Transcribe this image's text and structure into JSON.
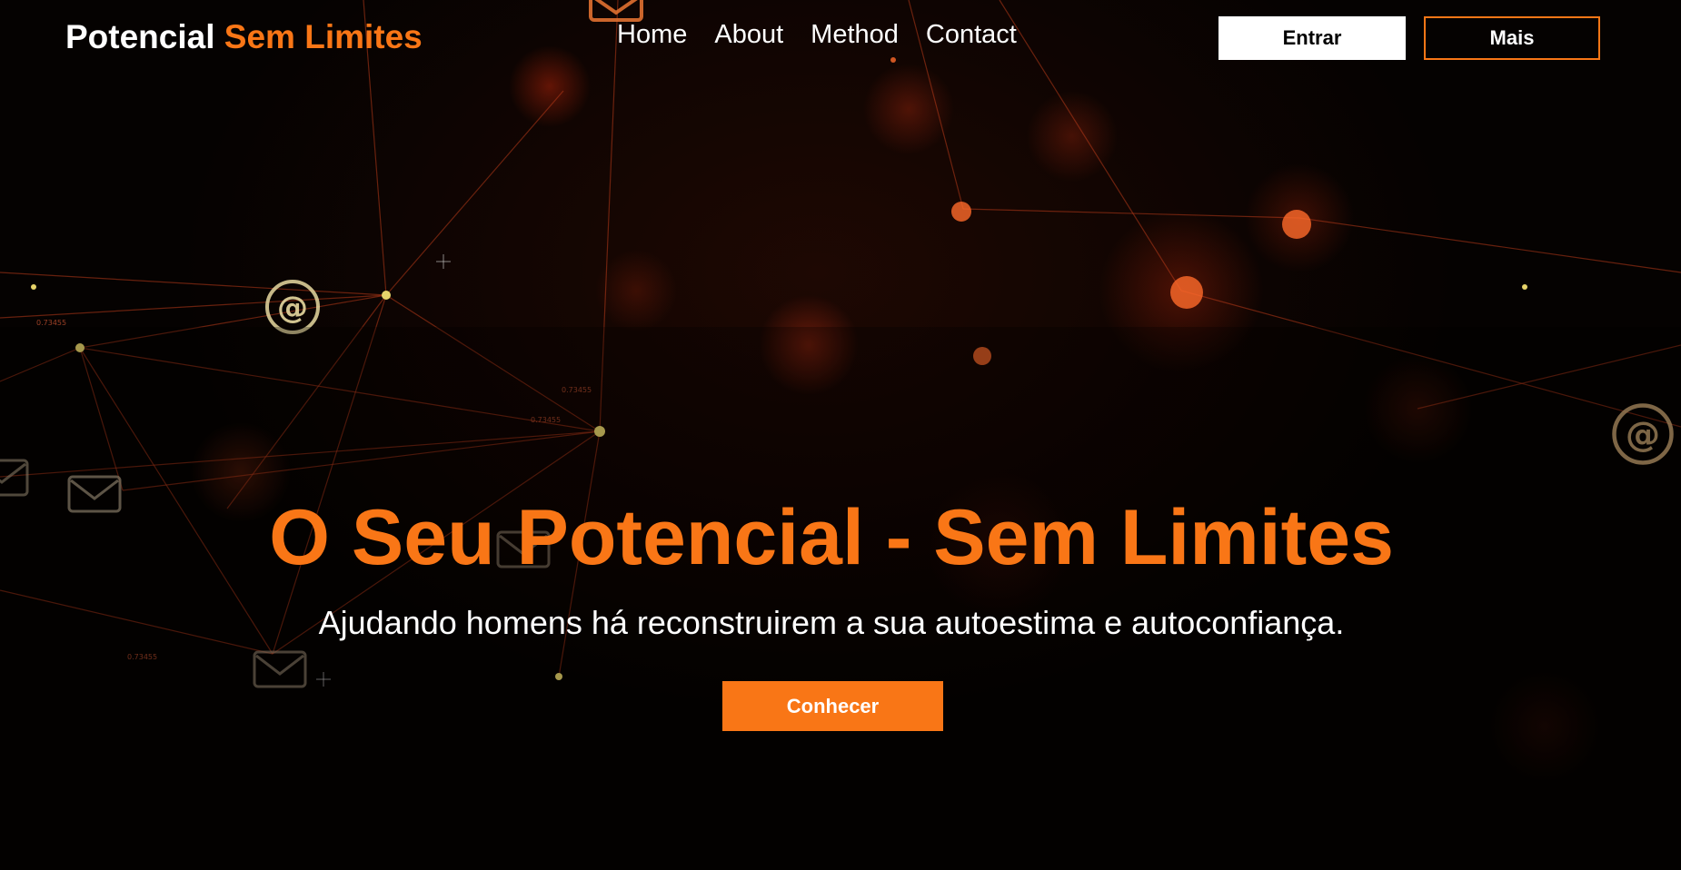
{
  "brand": {
    "first": "Potencial",
    "second": "Sem Limites"
  },
  "nav": {
    "items": [
      "Home",
      "About",
      "Method",
      "Contact"
    ]
  },
  "header_buttons": {
    "login_label": "Entrar",
    "more_label": "Mais"
  },
  "hero": {
    "title": "O Seu Potencial - Sem Limites",
    "subtitle": "Ajudando homens há reconstruirem a sua autoestima e autoconfiança.",
    "cta_label": "Conhecer"
  },
  "colors": {
    "accent": "#f97616",
    "background": "#050201",
    "text": "#ffffff"
  },
  "background_icons": [
    "at-sign-icon",
    "envelope-icon"
  ]
}
